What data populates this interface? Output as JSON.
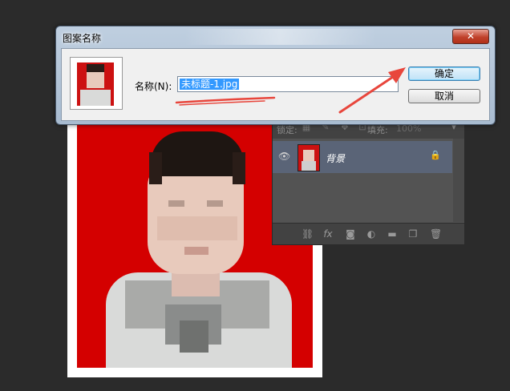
{
  "dialog": {
    "title": "图案名称",
    "close_label": "✕",
    "name_label": "名称(N):",
    "name_value": "未标题-1.jpg",
    "ok_label": "确定",
    "cancel_label": "取消"
  },
  "layers": {
    "lock_label": "锁定:",
    "fill_label": "填充:",
    "fill_value": "100%",
    "layer_name": "背景"
  },
  "icons": {
    "close": "close-icon",
    "eye": "eye-icon",
    "lock": "lock-icon",
    "link": "link-icon",
    "fx": "fx-icon",
    "mask": "mask-icon",
    "adjustment": "adjustment-icon",
    "folder": "folder-icon",
    "new_layer": "new-layer-icon",
    "trash": "trash-icon"
  },
  "colors": {
    "photo_background": "#d40000",
    "annotation": "#e8463c",
    "selection": "#3399ff",
    "dialog_frame": "#bfcfe0"
  }
}
